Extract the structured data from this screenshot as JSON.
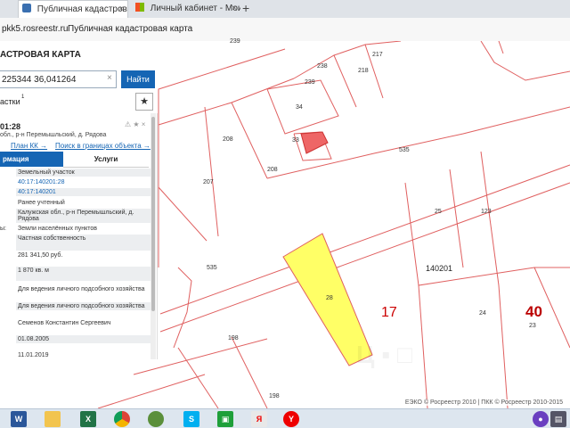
{
  "browser": {
    "tabs": [
      {
        "title": "Публичная кадастровая"
      },
      {
        "title": "Личный кабинет - Мои об"
      }
    ],
    "new_tab": "+",
    "close": "×",
    "address": "pkk5.rosreestr.ru",
    "page_title": "Публичная кадастровая карта"
  },
  "panel": {
    "title": "АСТРОВАЯ КАРТА",
    "search": {
      "value": "225344 36,041264",
      "clear": "×",
      "button": "Найти"
    },
    "plots_label": "астки",
    "plots_count": "1",
    "star": "★",
    "card": {
      "number": "01:28",
      "icons": "⚠ ★ ×",
      "address": "обл., р-н Перемышльский, д. Рядова",
      "link_kk": "План КК →",
      "link_search": "Поиск в границах объекта →",
      "tab_info": "рмация",
      "tab_services": "Услуги",
      "rows": [
        {
          "label": "",
          "value": "Земельный участок"
        },
        {
          "label": "",
          "value": "40:17:140201:28",
          "link": true
        },
        {
          "label": "",
          "value": "40:17:140201",
          "link": true
        },
        {
          "label": "",
          "value": "Ранее учтенный"
        },
        {
          "label": "",
          "value": "Калужская обл., р-н Перемышльский, д. Рядова"
        },
        {
          "label": "ы:",
          "value": "Земли населённых пунктов"
        },
        {
          "label": "",
          "value": "Частная собственность"
        },
        {
          "label": "",
          "value": "281 341,50 руб."
        },
        {
          "label": "",
          "value": "1 870 кв. м"
        },
        {
          "label": "",
          "value": "Для ведения личного подсобного хозяйства"
        },
        {
          "label": "",
          "value": "Для ведения личного подсобного хозяйства"
        },
        {
          "label": "",
          "value": "Семенов Константин Сергеевич"
        },
        {
          "label": "",
          "value": "01.08.2005"
        },
        {
          "label": "",
          "value": "11.01.2019"
        }
      ]
    }
  },
  "map": {
    "plots": [
      "239",
      "217",
      "238",
      "218",
      "239",
      "34",
      "33",
      "535",
      "208",
      "207",
      "208",
      "25",
      "123",
      "535",
      "28",
      "24",
      "23",
      "198",
      "198"
    ],
    "quarter": "140201",
    "big_17": "17",
    "big_40": "40",
    "copyright": "ЕЭКО © Росреестр 2010 | ПКК © Росреестр 2010-2015"
  },
  "colors": {
    "boundary": "#e06060",
    "highlight": "#ffff66",
    "accent": "#1565b4"
  },
  "taskbar": {
    "icons": [
      "word-icon",
      "explorer-icon",
      "excel-icon",
      "chrome-icon",
      "globe-icon",
      "skype-icon",
      "store-icon",
      "yandex-icon",
      "yandex-browser-icon"
    ]
  }
}
